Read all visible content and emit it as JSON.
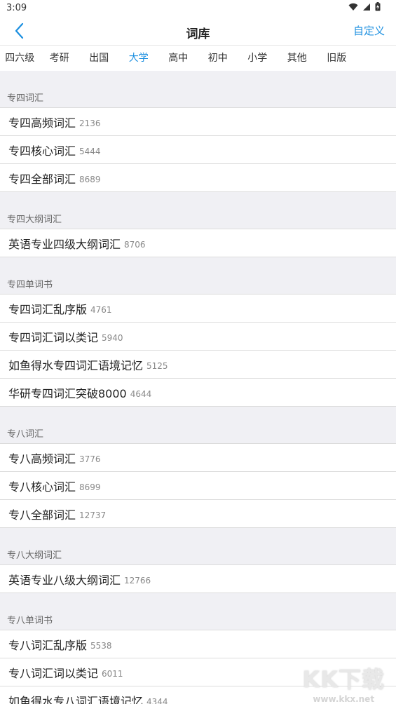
{
  "status_bar": {
    "time": "3:09"
  },
  "navbar": {
    "title": "词库",
    "custom_label": "自定义"
  },
  "tabs": [
    "四六级",
    "考研",
    "出国",
    "大学",
    "高中",
    "初中",
    "小学",
    "其他",
    "旧版"
  ],
  "active_tab": "大学",
  "sections": [
    {
      "title": "专四词汇",
      "items": [
        {
          "name": "专四高频词汇",
          "count": "2136"
        },
        {
          "name": "专四核心词汇",
          "count": "5444"
        },
        {
          "name": "专四全部词汇",
          "count": "8689"
        }
      ]
    },
    {
      "title": "专四大纲词汇",
      "items": [
        {
          "name": "英语专业四级大纲词汇",
          "count": "8706"
        }
      ]
    },
    {
      "title": "专四单词书",
      "items": [
        {
          "name": "专四词汇乱序版",
          "count": "4761"
        },
        {
          "name": "专四词汇词以类记",
          "count": "5940"
        },
        {
          "name": "如鱼得水专四词汇语境记忆",
          "count": "5125"
        },
        {
          "name": "华研专四词汇突破8000",
          "count": "4644"
        }
      ]
    },
    {
      "title": "专八词汇",
      "items": [
        {
          "name": "专八高频词汇",
          "count": "3776"
        },
        {
          "name": "专八核心词汇",
          "count": "8699"
        },
        {
          "name": "专八全部词汇",
          "count": "12737"
        }
      ]
    },
    {
      "title": "专八大纲词汇",
      "items": [
        {
          "name": "英语专业八级大纲词汇",
          "count": "12766"
        }
      ]
    },
    {
      "title": "专八单词书",
      "items": [
        {
          "name": "专八词汇乱序版",
          "count": "5538"
        },
        {
          "name": "专八词汇词以类记",
          "count": "6011"
        },
        {
          "name": "如鱼得水专八词汇语境记忆",
          "count": "4344"
        }
      ]
    }
  ],
  "watermark": {
    "logo": "KK下载",
    "url": "www.kkx.net"
  },
  "colors": {
    "accent": "#1b8fe0",
    "background": "#f0f0f4"
  }
}
